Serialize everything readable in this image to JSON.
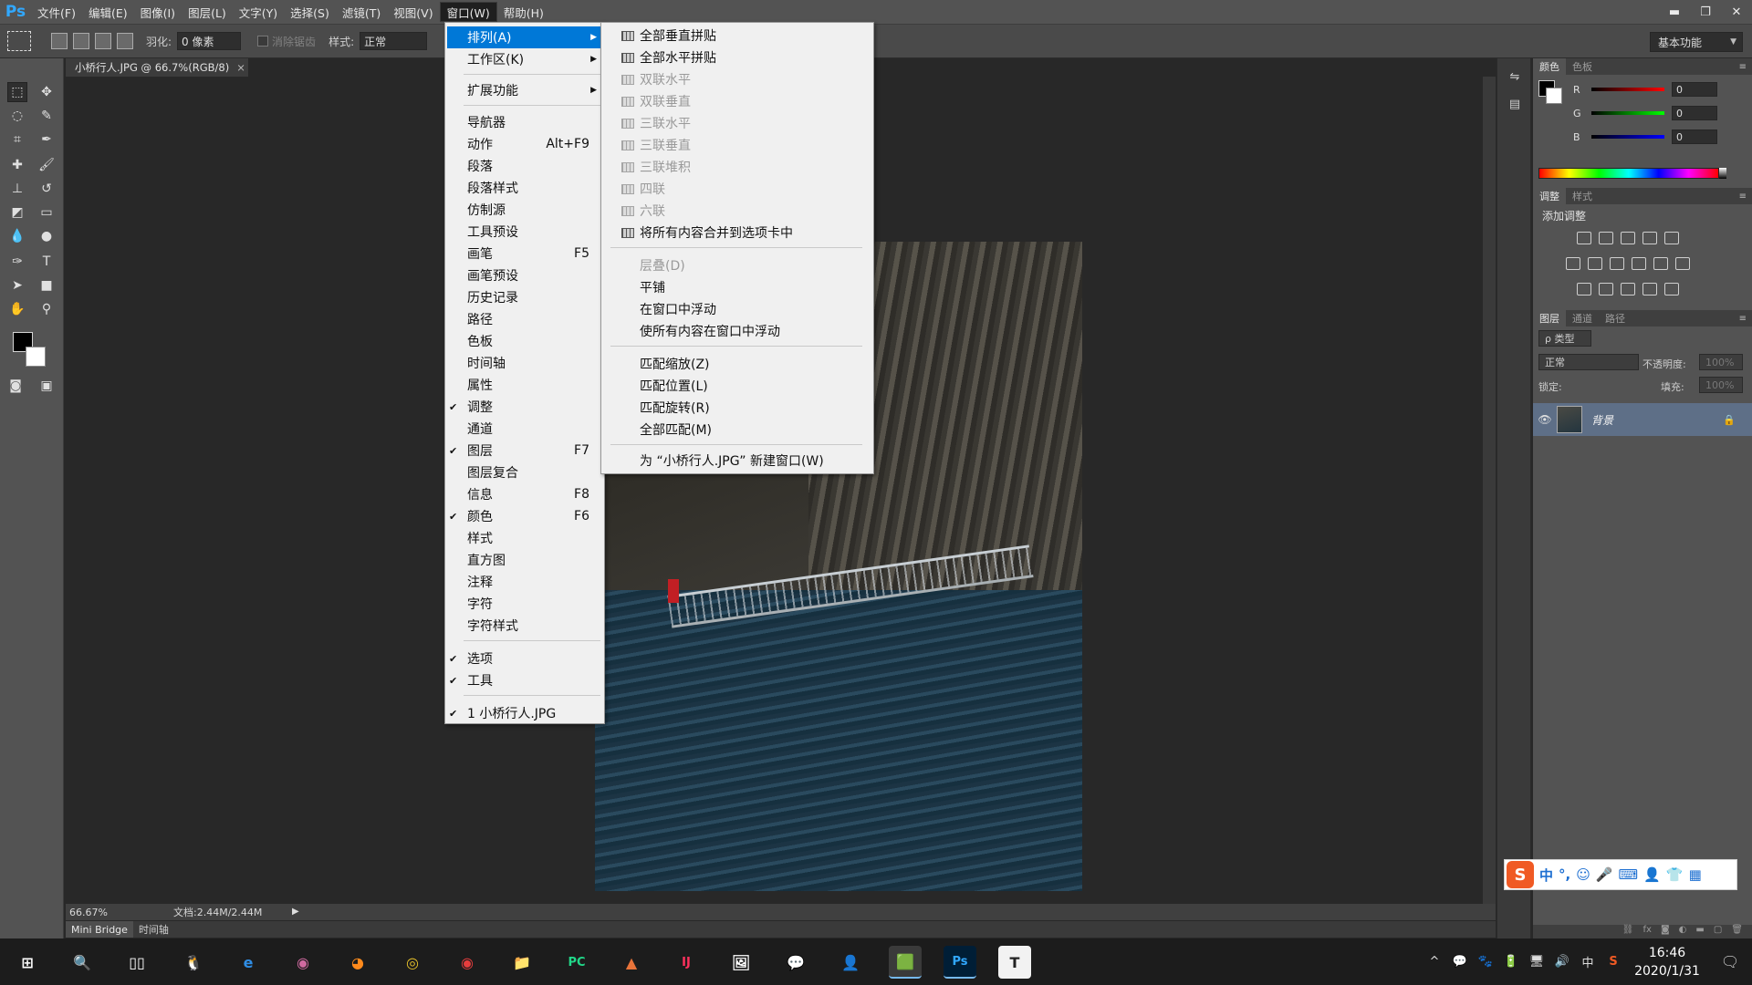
{
  "menubar": {
    "logo": "Ps",
    "items": [
      {
        "label": "文件(F)"
      },
      {
        "label": "编辑(E)"
      },
      {
        "label": "图像(I)"
      },
      {
        "label": "图层(L)"
      },
      {
        "label": "文字(Y)"
      },
      {
        "label": "选择(S)"
      },
      {
        "label": "滤镜(T)"
      },
      {
        "label": "视图(V)"
      },
      {
        "label": "窗口(W)"
      },
      {
        "label": "帮助(H)"
      }
    ],
    "window_controls": {
      "minimize": "▬",
      "restore": "❐",
      "close": "✕"
    }
  },
  "options_bar": {
    "feather_label": "羽化:",
    "feather_value": "0 像素",
    "antialias_label": "消除锯齿",
    "style_label": "样式:",
    "style_value": "正常",
    "workspace_value": "基本功能"
  },
  "document": {
    "tab_title": "小桥行人.JPG @ 66.7%(RGB/8)",
    "tab_close": "×",
    "zoom": "66.67%",
    "doc_info": "文档:2.44M/2.44M"
  },
  "bottom_tabs": [
    {
      "label": "Mini Bridge"
    },
    {
      "label": "时间轴"
    }
  ],
  "window_menu": {
    "items": [
      {
        "label": "排列(A)",
        "submenu": true,
        "highlighted": true
      },
      {
        "label": "工作区(K)",
        "submenu": true
      },
      {
        "label": "扩展功能",
        "submenu": true
      },
      {
        "label": "导航器"
      },
      {
        "label": "动作",
        "shortcut": "Alt+F9"
      },
      {
        "label": "段落"
      },
      {
        "label": "段落样式"
      },
      {
        "label": "仿制源"
      },
      {
        "label": "工具预设"
      },
      {
        "label": "画笔",
        "shortcut": "F5"
      },
      {
        "label": "画笔预设"
      },
      {
        "label": "历史记录"
      },
      {
        "label": "路径"
      },
      {
        "label": "色板"
      },
      {
        "label": "时间轴"
      },
      {
        "label": "属性"
      },
      {
        "label": "调整",
        "checked": true
      },
      {
        "label": "通道"
      },
      {
        "label": "图层",
        "checked": true,
        "shortcut": "F7"
      },
      {
        "label": "图层复合"
      },
      {
        "label": "信息",
        "shortcut": "F8"
      },
      {
        "label": "颜色",
        "checked": true,
        "shortcut": "F6"
      },
      {
        "label": "样式"
      },
      {
        "label": "直方图"
      },
      {
        "label": "注释"
      },
      {
        "label": "字符"
      },
      {
        "label": "字符样式"
      },
      {
        "label": "选项",
        "checked": true
      },
      {
        "label": "工具",
        "checked": true
      },
      {
        "label": "1 小桥行人.JPG",
        "checked": true
      }
    ],
    "check_glyph": "✔",
    "arrow_glyph": "▶"
  },
  "arrange_submenu": {
    "items": [
      {
        "label": "全部垂直拼贴",
        "icon": true
      },
      {
        "label": "全部水平拼贴",
        "icon": true
      },
      {
        "label": "双联水平",
        "icon": true,
        "disabled": true
      },
      {
        "label": "双联垂直",
        "icon": true,
        "disabled": true
      },
      {
        "label": "三联水平",
        "icon": true,
        "disabled": true
      },
      {
        "label": "三联垂直",
        "icon": true,
        "disabled": true
      },
      {
        "label": "三联堆积",
        "icon": true,
        "disabled": true
      },
      {
        "label": "四联",
        "icon": true,
        "disabled": true
      },
      {
        "label": "六联",
        "icon": true,
        "disabled": true
      },
      {
        "label": "将所有内容合并到选项卡中",
        "icon": true
      },
      {
        "label": "层叠(D)",
        "disabled": true
      },
      {
        "label": "平铺"
      },
      {
        "label": "在窗口中浮动"
      },
      {
        "label": "使所有内容在窗口中浮动"
      },
      {
        "label": "匹配缩放(Z)"
      },
      {
        "label": "匹配位置(L)"
      },
      {
        "label": "匹配旋转(R)"
      },
      {
        "label": "全部匹配(M)"
      },
      {
        "label": "为 “小桥行人.JPG” 新建窗口(W)"
      }
    ]
  },
  "color_panel": {
    "tabs": [
      {
        "label": "颜色"
      },
      {
        "label": "色板"
      }
    ],
    "r_label": "R",
    "g_label": "G",
    "b_label": "B",
    "r_value": "0",
    "g_value": "0",
    "b_value": "0"
  },
  "adjust_panel": {
    "tabs": [
      {
        "label": "调整"
      },
      {
        "label": "样式"
      }
    ],
    "add_label": "添加调整"
  },
  "layers_panel": {
    "tabs": [
      {
        "label": "图层"
      },
      {
        "label": "通道"
      },
      {
        "label": "路径"
      }
    ],
    "filter_label": "ρ 类型",
    "blend_mode": "正常",
    "opacity_label": "不透明度:",
    "opacity_value": "100%",
    "lock_label": "锁定:",
    "fill_label": "填充:",
    "fill_value": "100%",
    "layer_name": "背景"
  },
  "ime": {
    "logo": "S",
    "items": [
      "中",
      "°,",
      "☺",
      "🎤",
      "⌨",
      "👤",
      "👕",
      "▦"
    ]
  },
  "taskbar": {
    "apps": [
      "⊞",
      "🔍",
      "▯▯",
      "🐧",
      "e",
      "◉",
      "◕",
      "◎",
      "◉",
      "📁",
      "PC",
      "▲",
      "IJ",
      "🖼",
      "💬",
      "👤",
      "🟩",
      "Ps",
      "T"
    ],
    "tray": [
      "^",
      "💬",
      "🐾",
      "🔋",
      "🖥",
      "🔊",
      "中",
      "S"
    ],
    "time": "16:46",
    "date": "2020/1/31",
    "notification": "🗨"
  }
}
